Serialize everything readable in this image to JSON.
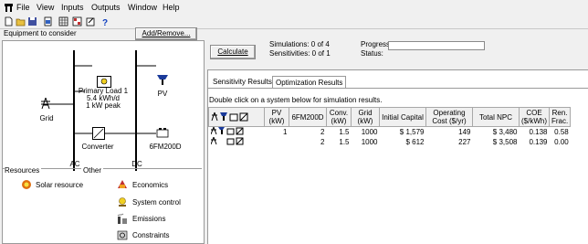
{
  "menu": [
    "File",
    "View",
    "Inputs",
    "Outputs",
    "Window",
    "Help"
  ],
  "left_panel": {
    "title": "Equipment to consider",
    "add_remove_label": "Add/Remove...",
    "primary_load": [
      "Primary Load 1",
      "5.4 kWh/d",
      "1 kW peak"
    ],
    "grid_label": "Grid",
    "pv_label": "PV",
    "converter_label": "Converter",
    "battery_label": "6FM200D",
    "ac_label": "AC",
    "dc_label": "DC",
    "resources_label": "Resources",
    "other_label": "Other",
    "solar_resource": "Solar resource",
    "economics": "Economics",
    "system_control": "System control",
    "emissions": "Emissions",
    "constraints": "Constraints"
  },
  "calc": {
    "button": "Calculate",
    "simulations": "Simulations: 0 of 4",
    "sensitivities": "Sensitivities: 0 of 1",
    "progress_label": "Progress:",
    "status_label": "Status:"
  },
  "tabs": [
    "Sensitivity Results",
    "Optimization Results"
  ],
  "hint": "Double click on a system below for simulation results.",
  "table": {
    "headers": [
      "PV (kW)",
      "6FM200D",
      "Conv. (kW)",
      "Grid (kW)",
      "Initial Capital",
      "Operating Cost ($/yr)",
      "Total NPC",
      "COE ($/kWh)",
      "Ren. Frac."
    ],
    "rows": [
      [
        "1",
        "2",
        "1.5",
        "1000",
        "$ 1,579",
        "149",
        "$ 3,480",
        "0.138",
        "0.58"
      ],
      [
        "",
        "2",
        "1.5",
        "1000",
        "$ 612",
        "227",
        "$ 3,508",
        "0.139",
        "0.00"
      ]
    ]
  },
  "colors": {
    "grid_icon": "#000000",
    "pv_blue": "#1a3a9a",
    "solar_orange": "#e07010"
  }
}
